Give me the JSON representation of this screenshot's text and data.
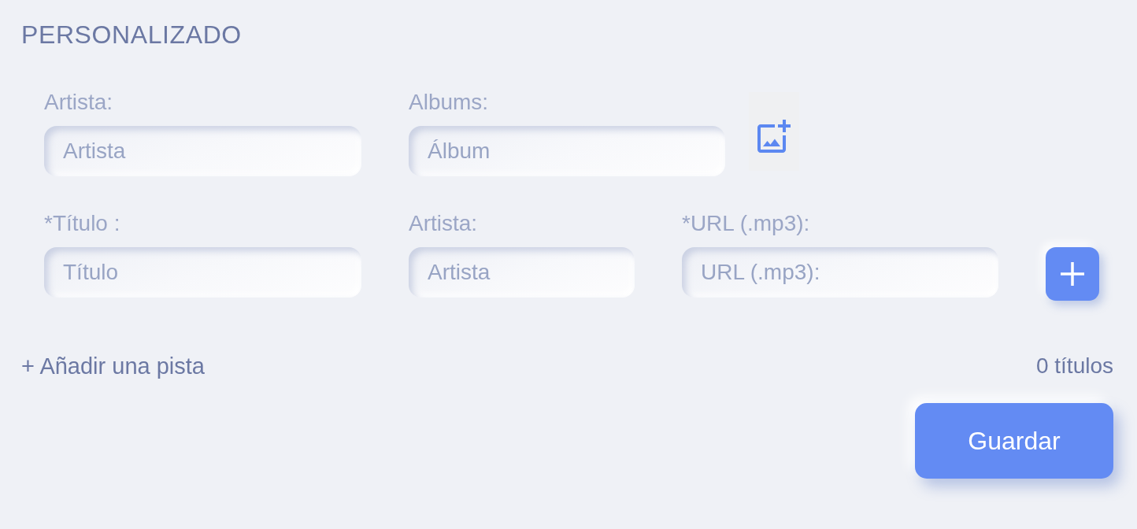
{
  "section_title": "PERSONALIZADO",
  "album_fields": [
    {
      "label": "Artista:",
      "placeholder": "Artista"
    },
    {
      "label": "Albums:",
      "placeholder": "Álbum"
    }
  ],
  "track_fields": [
    {
      "label": "*Título :",
      "placeholder": "Título"
    },
    {
      "label": "Artista:",
      "placeholder": "Artista"
    },
    {
      "label": "*URL (.mp3):",
      "placeholder": "URL (.mp3):"
    }
  ],
  "add_track_link": "+ Añadir una pista",
  "track_count": "0 títulos",
  "save_button": "Guardar"
}
